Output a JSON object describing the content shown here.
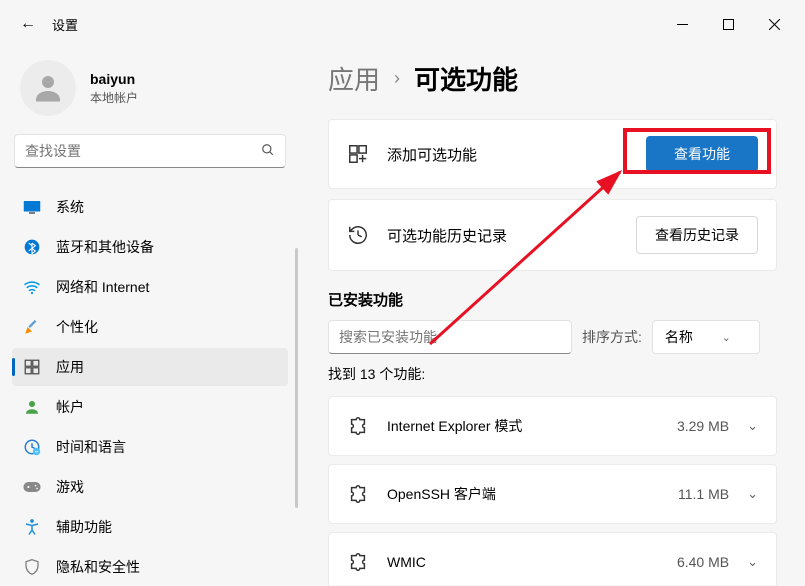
{
  "titlebar": {
    "title": "设置"
  },
  "profile": {
    "name": "baiyun",
    "type": "本地帐户"
  },
  "search": {
    "placeholder": "查找设置"
  },
  "nav": [
    {
      "label": "系统",
      "icon": "system"
    },
    {
      "label": "蓝牙和其他设备",
      "icon": "bluetooth"
    },
    {
      "label": "网络和 Internet",
      "icon": "network"
    },
    {
      "label": "个性化",
      "icon": "personalize"
    },
    {
      "label": "应用",
      "icon": "apps",
      "active": true
    },
    {
      "label": "帐户",
      "icon": "accounts"
    },
    {
      "label": "时间和语言",
      "icon": "time"
    },
    {
      "label": "游戏",
      "icon": "gaming"
    },
    {
      "label": "辅助功能",
      "icon": "accessibility"
    },
    {
      "label": "隐私和安全性",
      "icon": "privacy"
    }
  ],
  "breadcrumb": {
    "parent": "应用",
    "current": "可选功能"
  },
  "cards": {
    "add": {
      "label": "添加可选功能",
      "button": "查看功能"
    },
    "history": {
      "label": "可选功能历史记录",
      "button": "查看历史记录"
    }
  },
  "installed": {
    "title": "已安装功能",
    "search_placeholder": "搜索已安装功能",
    "sort_label": "排序方式:",
    "sort_value": "名称",
    "found": "找到 13 个功能:"
  },
  "features": [
    {
      "name": "Internet Explorer 模式",
      "size": "3.29 MB"
    },
    {
      "name": "OpenSSH 客户端",
      "size": "11.1 MB"
    },
    {
      "name": "WMIC",
      "size": "6.40 MB"
    }
  ]
}
